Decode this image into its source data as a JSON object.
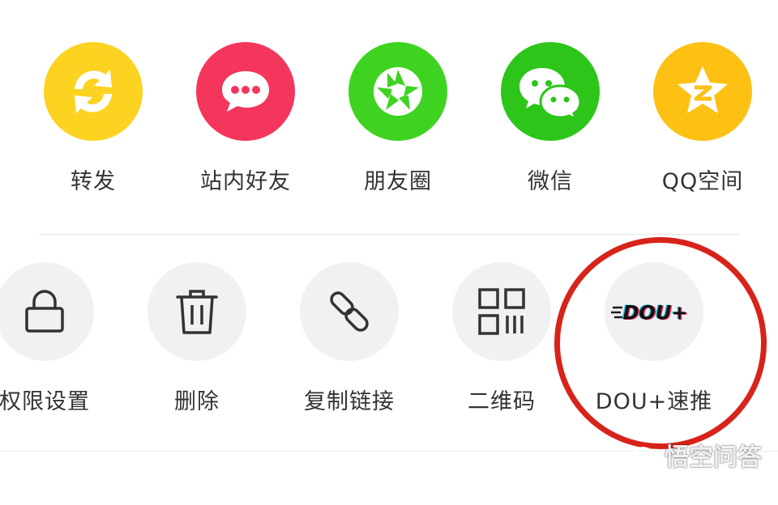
{
  "share_row": [
    {
      "label": "转发",
      "icon": "repost-icon",
      "color": "#FCD320"
    },
    {
      "label": "站内好友",
      "icon": "chat-bubble-icon",
      "color": "#F5365C"
    },
    {
      "label": "朋友圈",
      "icon": "moments-shutter-icon",
      "color": "#3FD321"
    },
    {
      "label": "微信",
      "icon": "wechat-icon",
      "color": "#2DC51A"
    },
    {
      "label": "QQ空间",
      "icon": "qzone-star-icon",
      "color": "#FDC114"
    }
  ],
  "action_row": [
    {
      "label": "权限设置",
      "icon": "lock-icon"
    },
    {
      "label": "删除",
      "icon": "trash-icon"
    },
    {
      "label": "复制链接",
      "icon": "link-icon"
    },
    {
      "label": "二维码",
      "icon": "qr-code-icon"
    },
    {
      "label": "DOU+速推",
      "icon": "dou-plus-logo",
      "logo_text": "DOU+"
    }
  ],
  "highlight_color": "#D8231A",
  "watermark": {
    "text": "悟空问答",
    "icon": "wukong-logo-icon"
  }
}
